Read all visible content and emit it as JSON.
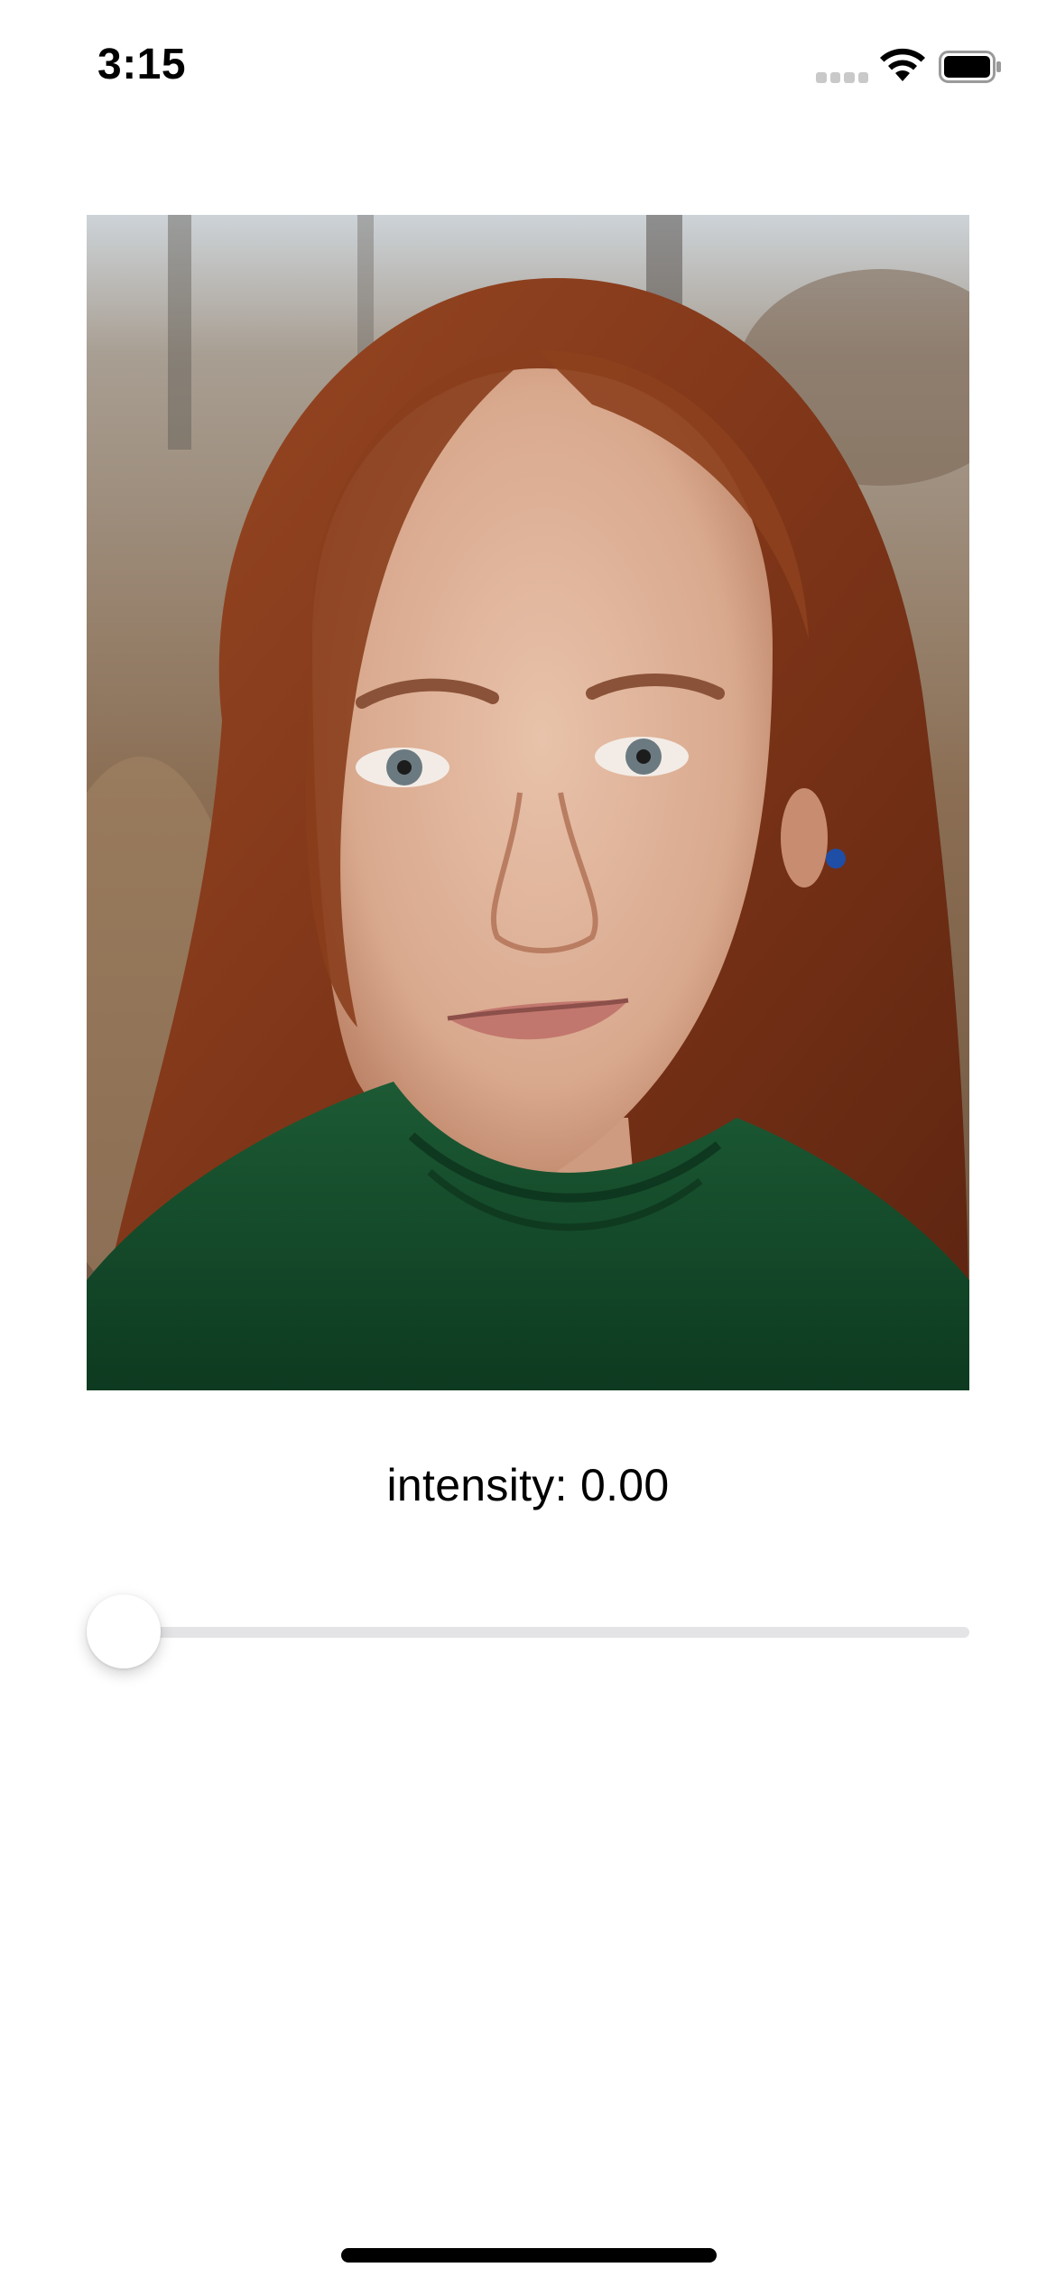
{
  "status_bar": {
    "time": "3:15",
    "signal_icon": "cellular-signal-icon",
    "wifi_icon": "wifi-icon",
    "battery_icon": "battery-icon"
  },
  "photo": {
    "icon": "portrait-photo"
  },
  "intensity": {
    "label": "intensity: 0.00",
    "value": 0.0,
    "min": 0.0,
    "max": 1.0
  },
  "colors": {
    "slider_track": "#e4e4e6",
    "slider_thumb": "#ffffff",
    "home_indicator": "#000000"
  }
}
